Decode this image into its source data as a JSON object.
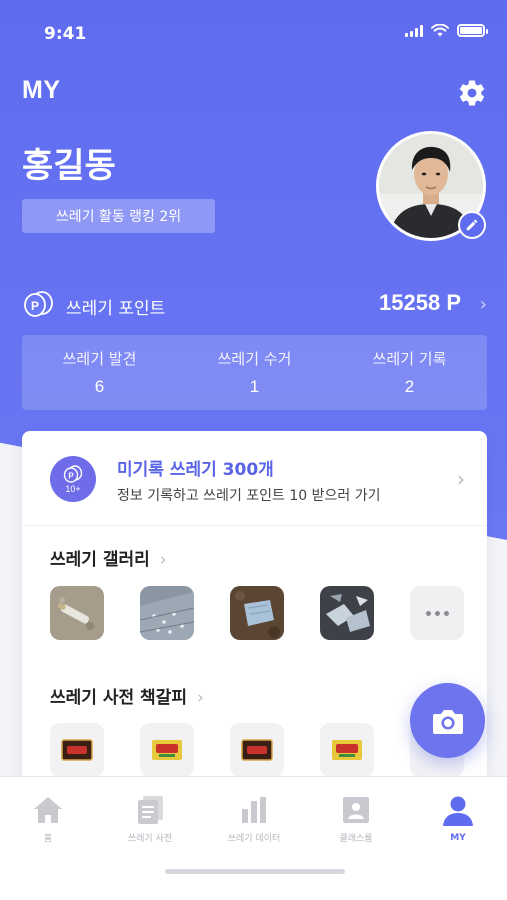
{
  "status_bar": {
    "time": "9:41"
  },
  "header": {
    "title": "MY",
    "settings_icon": "gear-icon"
  },
  "profile": {
    "name": "홍길동",
    "rank_badge": "쓰레기 활동 랭킹 2위",
    "avatar_icon": "avatar",
    "edit_icon": "pencil-icon"
  },
  "points": {
    "label": "쓰레기 포인트",
    "value": "15258 P",
    "chevron": "›"
  },
  "stats": [
    {
      "label": "쓰레기 발견",
      "value": "6"
    },
    {
      "label": "쓰레기 수거",
      "value": "1"
    },
    {
      "label": "쓰레기 기록",
      "value": "2"
    }
  ],
  "promo": {
    "icon_text": "10+",
    "title": "미기록 쓰레기 300개",
    "description": "정보 기록하고 쓰레기 포인트 10 받으러 가기",
    "chevron": "›"
  },
  "gallery": {
    "title": "쓰레기 갤러리",
    "chevron": "›"
  },
  "bookmarks": {
    "title": "쓰레기 사전 책갈피",
    "chevron": "›"
  },
  "tabs": [
    {
      "label": "홈",
      "icon": "home-icon"
    },
    {
      "label": "쓰레기 사전",
      "icon": "dictionary-icon"
    },
    {
      "label": "쓰레기 데이터",
      "icon": "bar-chart-icon"
    },
    {
      "label": "클래스룸",
      "icon": "classroom-icon"
    },
    {
      "label": "MY",
      "icon": "person-icon"
    }
  ],
  "colors": {
    "primary": "#5f6cf0",
    "promo_title": "#5a64e6",
    "fab": "#6e73ee"
  }
}
